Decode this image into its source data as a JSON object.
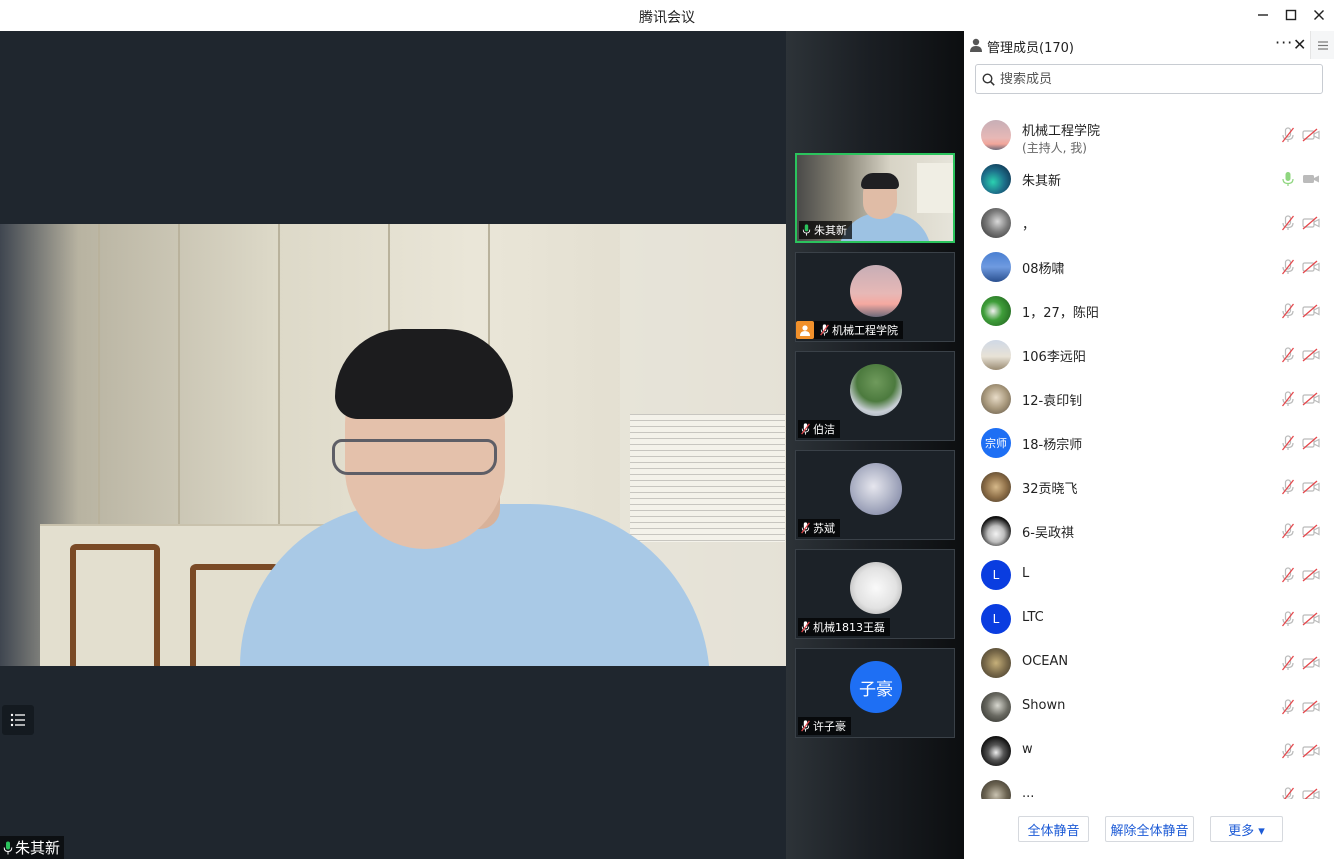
{
  "window": {
    "title": "腾讯会议"
  },
  "main": {
    "speaker_name": "朱其新"
  },
  "gallery": [
    {
      "name": "朱其新",
      "type": "video",
      "mic": "on"
    },
    {
      "name": "机械工程学院",
      "type": "avatar",
      "host": true,
      "mic": "off"
    },
    {
      "name": "伯洁",
      "type": "avatar",
      "mic": "off"
    },
    {
      "name": "苏斌",
      "type": "avatar",
      "mic": "off"
    },
    {
      "name": "机械1813王磊",
      "type": "avatar",
      "mic": "off"
    },
    {
      "name": "许子豪",
      "type": "initials",
      "initials": "子豪",
      "mic": "off"
    }
  ],
  "panel": {
    "title": "管理成员(170)",
    "search_placeholder": "搜索成员",
    "members": [
      {
        "name": "机械工程学院",
        "sub": "(主持人, 我)",
        "mic": "off"
      },
      {
        "name": "朱其新",
        "mic": "on"
      },
      {
        "name": "，",
        "mic": "off"
      },
      {
        "name": "08杨啸",
        "mic": "off"
      },
      {
        "name": "1，27，陈阳",
        "mic": "off"
      },
      {
        "name": "106李远阳",
        "mic": "off"
      },
      {
        "name": "12-袁印钊",
        "mic": "off"
      },
      {
        "name": "18-杨宗师",
        "initials": "宗师",
        "mic": "off"
      },
      {
        "name": "32贡晓飞",
        "mic": "off"
      },
      {
        "name": "6-吴政祺",
        "mic": "off"
      },
      {
        "name": "L",
        "initials": "L",
        "mic": "off"
      },
      {
        "name": "LTC",
        "initials": "L",
        "mic": "off"
      },
      {
        "name": "OCEAN",
        "mic": "off"
      },
      {
        "name": "Shown",
        "mic": "off"
      },
      {
        "name": "w",
        "mic": "off"
      },
      {
        "name": "...",
        "mic": "off"
      }
    ],
    "footer": {
      "mute_all": "全体静音",
      "unmute_all": "解除全体静音",
      "more": "更多 ▾"
    }
  },
  "colors": {
    "accent": "#1d5bd6",
    "active_border": "#2bc35d",
    "host_badge": "#f0902b",
    "initials_bg": "#1e6ff4"
  }
}
